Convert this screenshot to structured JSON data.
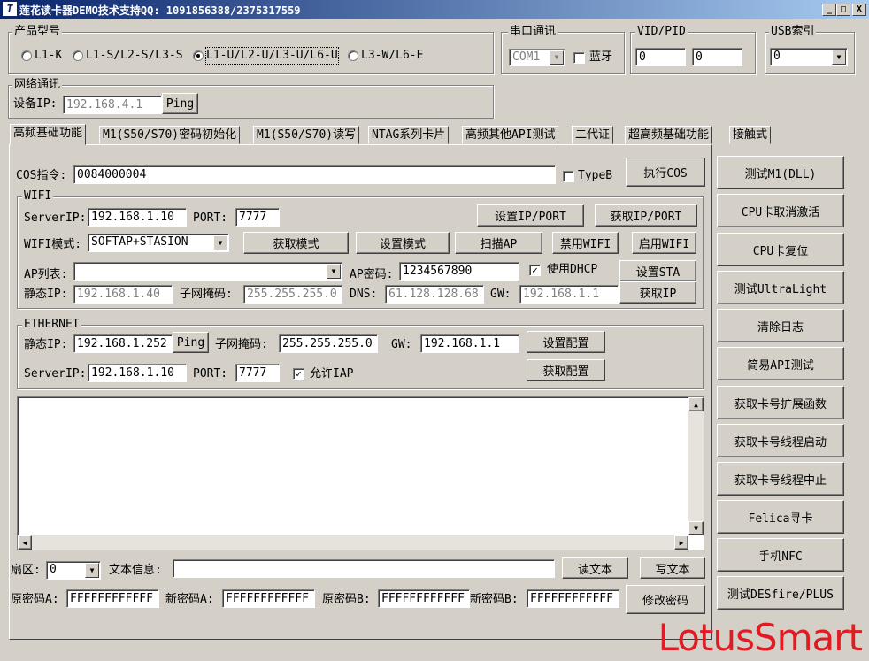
{
  "window": {
    "title": "莲花读卡器DEMO技术支持QQ: 1091856388/2375317559",
    "icon_text": "T",
    "min": "_",
    "max": "□",
    "close": "X"
  },
  "product": {
    "legend": "产品型号",
    "options": [
      "L1-K",
      "L1-S/L2-S/L3-S",
      "L1-U/L2-U/L3-U/L6-U",
      "L3-W/L6-E"
    ],
    "selected_index": 2
  },
  "serial": {
    "legend": "串口通讯",
    "port": "COM1",
    "bluetooth_label": "蓝牙"
  },
  "vidpid": {
    "legend": "VID/PID",
    "vid": "0",
    "pid": "0"
  },
  "usb": {
    "legend": "USB索引",
    "index": "0"
  },
  "network": {
    "legend": "网络通讯",
    "ip_label": "设备IP:",
    "ip": "192.168.4.1",
    "ping": "Ping"
  },
  "tabs": [
    "高频基础功能",
    "M1(S50/S70)密码初始化",
    "M1(S50/S70)读写",
    "NTAG系列卡片",
    "高频其他API测试",
    "二代证",
    "超高频基础功能",
    "接触式"
  ],
  "cos": {
    "label": "COS指令:",
    "value": "0084000004",
    "typeb": "TypeB",
    "exec": "执行COS"
  },
  "wifi": {
    "legend": "WIFI",
    "server_ip_label": "ServerIP:",
    "server_ip": "192.168.1.10",
    "port_label": "PORT:",
    "port": "7777",
    "set_ip_port": "设置IP/PORT",
    "get_ip_port": "获取IP/PORT",
    "mode_label": "WIFI模式:",
    "mode": "SOFTAP+STASION",
    "get_mode": "获取模式",
    "set_mode": "设置模式",
    "scan_ap": "扫描AP",
    "disable_wifi": "禁用WIFI",
    "enable_wifi": "启用WIFI",
    "ap_list_label": "AP列表:",
    "ap_list": "",
    "ap_pwd_label": "AP密码:",
    "ap_pwd": "1234567890",
    "dhcp_label": "使用DHCP",
    "set_sta": "设置STA",
    "static_ip_label": "静态IP:",
    "static_ip": "192.168.1.40",
    "mask_label": "子网掩码:",
    "mask": "255.255.255.0",
    "dns_label": "DNS:",
    "dns": "61.128.128.68",
    "gw_label": "GW:",
    "gw": "192.168.1.1",
    "get_ip": "获取IP"
  },
  "ethernet": {
    "legend": "ETHERNET",
    "static_ip_label": "静态IP:",
    "static_ip": "192.168.1.252",
    "ping": "Ping",
    "mask_label": "子网掩码:",
    "mask": "255.255.255.0",
    "gw_label": "GW:",
    "gw": "192.168.1.1",
    "set_config": "设置配置",
    "get_config": "获取配置",
    "server_ip_label": "ServerIP:",
    "server_ip": "192.168.1.10",
    "port_label": "PORT:",
    "port": "7777",
    "iap_label": "允许IAP"
  },
  "bottom": {
    "sector_label": "扇区:",
    "sector": "0",
    "text_label": "文本信息:",
    "text": "",
    "read_text": "读文本",
    "write_text": "写文本",
    "old_a_label": "原密码A:",
    "old_a": "FFFFFFFFFFFF",
    "new_a_label": "新密码A:",
    "new_a": "FFFFFFFFFFFF",
    "old_b_label": "原密码B:",
    "old_b": "FFFFFFFFFFFF",
    "new_b_label": "新密码B:",
    "new_b": "FFFFFFFFFFFF",
    "change_pwd": "修改密码"
  },
  "side_buttons": [
    "测试M1(DLL)",
    "CPU卡取消激活",
    "CPU卡复位",
    "测试UltraLight",
    "清除日志",
    "简易API测试",
    "获取卡号扩展函数",
    "获取卡号线程启动",
    "获取卡号线程中止",
    "Felica寻卡",
    "手机NFC",
    "测试DESfire/PLUS"
  ],
  "brand": "LotusSmart",
  "colors": {
    "titlebar": "#0a246a",
    "brand": "#e01b24",
    "face": "#d4d0c8"
  }
}
